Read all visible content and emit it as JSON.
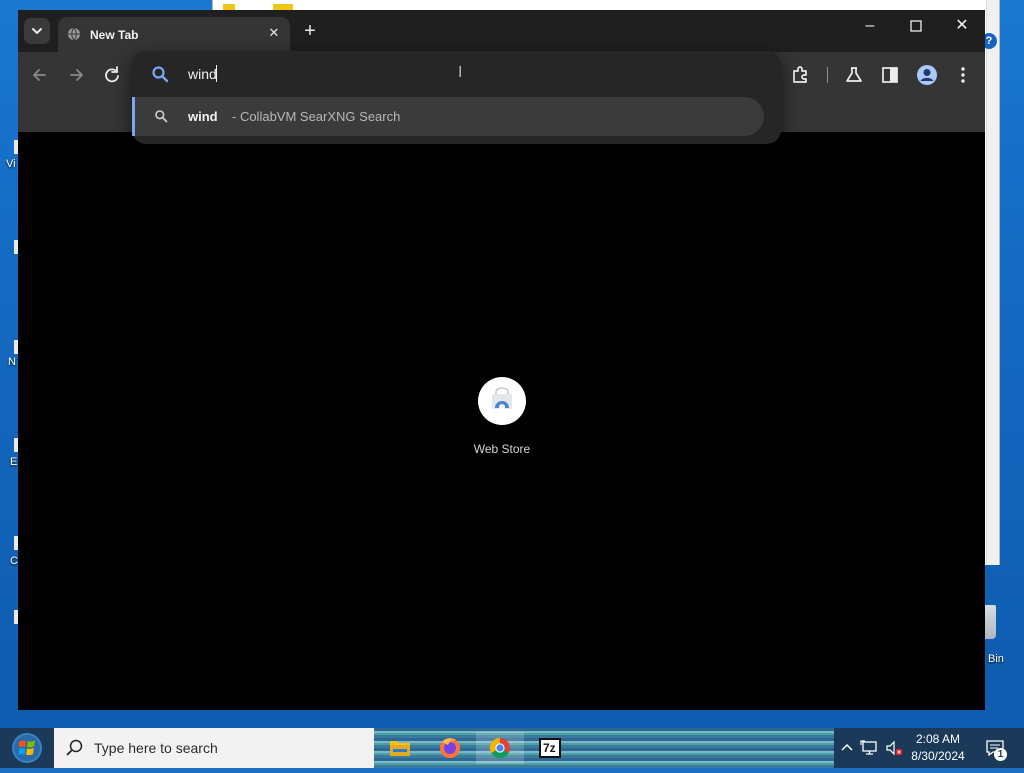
{
  "browser": {
    "tab": {
      "title": "New Tab"
    },
    "omnibox": {
      "value": "wind",
      "suggestion": {
        "query": "wind",
        "engine": "- CollabVM SearXNG Search"
      }
    },
    "shortcuts": [
      {
        "label": "Web Store"
      }
    ],
    "accent_color": "#7ca5f2"
  },
  "desktop": {
    "icon_labels": [
      "Vi",
      "N",
      "E",
      "C",
      "Bin"
    ]
  },
  "taskbar": {
    "search_placeholder": "Type here to search",
    "time": "2:08 AM",
    "date": "8/30/2024",
    "notification_count": "1",
    "apps": [
      "file-explorer",
      "firefox",
      "chrome",
      "7-zip"
    ],
    "seven_zip_label": "7z"
  }
}
